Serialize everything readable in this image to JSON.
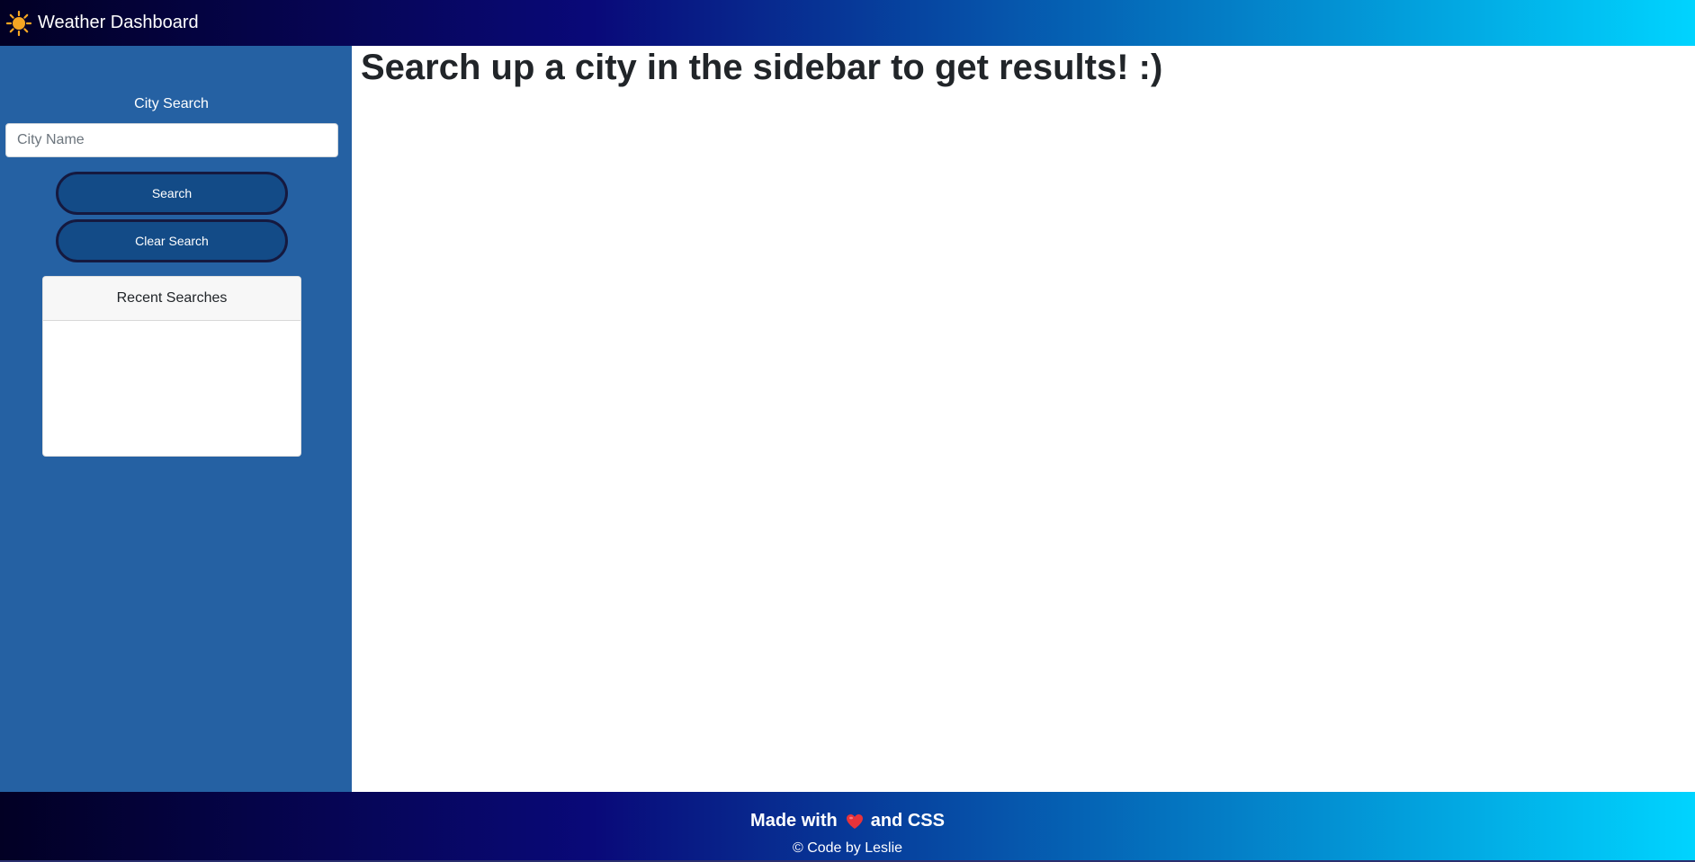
{
  "header": {
    "title": "Weather Dashboard",
    "icon": "sun-icon"
  },
  "sidebar": {
    "city_label": "City Search",
    "city_input": {
      "value": "",
      "placeholder": "City Name"
    },
    "search_label": "Search",
    "clear_label": "Clear Search",
    "recent": {
      "title": "Recent Searches",
      "items": []
    }
  },
  "main": {
    "heading": "Search up a city in the sidebar to get results! :)"
  },
  "footer": {
    "made_with_prefix": "Made with",
    "made_with_suffix": "and CSS",
    "heart_icon": "heart-icon",
    "copyright": "© Code by Leslie"
  },
  "colors": {
    "sidebar": "#2561a3",
    "button": "#134b87",
    "button_border": "#15193f",
    "gradient_start": "#020024",
    "gradient_mid": "#090979",
    "gradient_end": "#00d4ff",
    "sun": "#f5a623",
    "heart": "#e8333a"
  }
}
